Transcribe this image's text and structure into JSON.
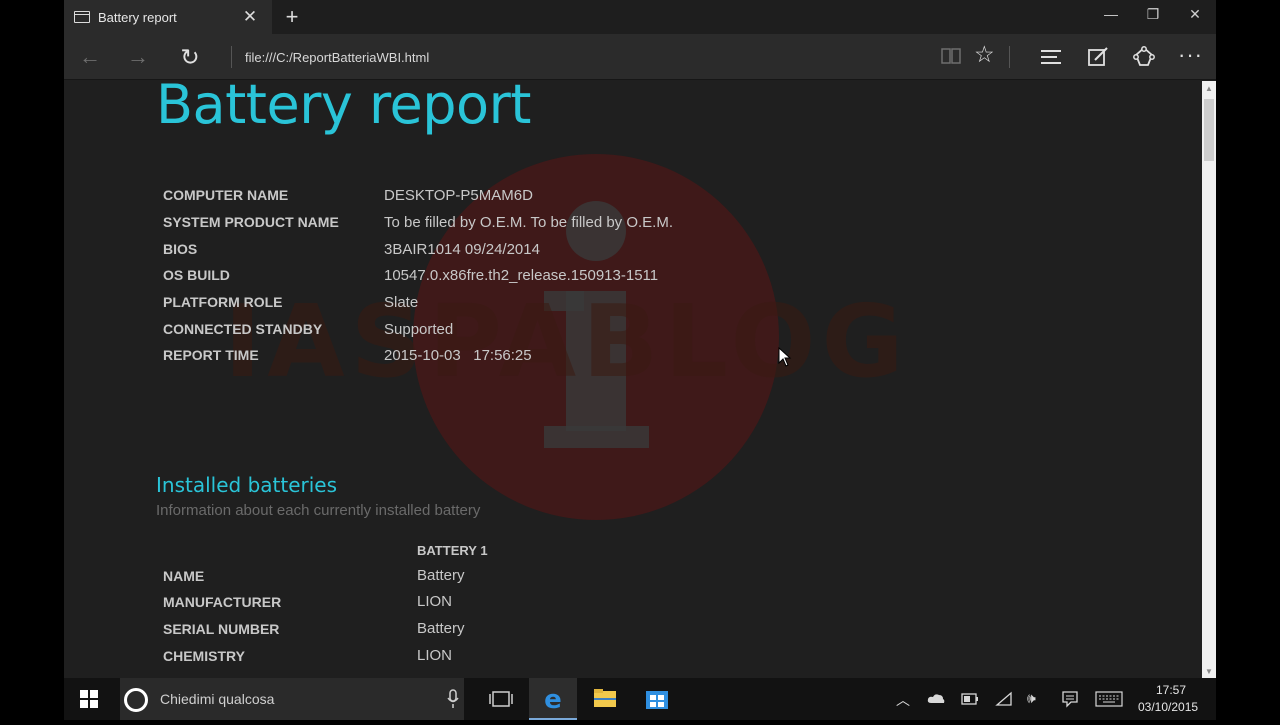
{
  "browser": {
    "tab_title": "Battery report",
    "url": "file:///C:/ReportBatteriaWBI.html",
    "icons": {
      "back": "arrow-left",
      "forward": "arrow-right",
      "refresh": "refresh",
      "reading_view": "book",
      "favorite": "star",
      "hub": "hamburger-lines",
      "web_note": "pen-square",
      "share": "share",
      "more": "ellipsis"
    }
  },
  "report": {
    "title": "Battery report",
    "info": [
      {
        "label": "COMPUTER NAME",
        "value": "DESKTOP-P5MAM6D"
      },
      {
        "label": "SYSTEM PRODUCT NAME",
        "value": "To be filled by O.E.M. To be filled by O.E.M."
      },
      {
        "label": "BIOS",
        "value": "3BAIR1014 09/24/2014"
      },
      {
        "label": "OS BUILD",
        "value": "10547.0.x86fre.th2_release.150913-1511"
      },
      {
        "label": "PLATFORM ROLE",
        "value": "Slate"
      },
      {
        "label": "CONNECTED STANDBY",
        "value": "Supported"
      },
      {
        "label": "REPORT TIME",
        "value": "2015-10-03   17:56:25"
      }
    ],
    "installed": {
      "title": "Installed batteries",
      "subtitle": "Information about each currently installed battery",
      "column_header": "BATTERY 1",
      "rows": [
        {
          "label": "NAME",
          "value": "Battery"
        },
        {
          "label": "MANUFACTURER",
          "value": "LION"
        },
        {
          "label": "SERIAL NUMBER",
          "value": "Battery"
        },
        {
          "label": "CHEMISTRY",
          "value": "LION"
        }
      ]
    },
    "watermark_text": "IASPABLOG"
  },
  "taskbar": {
    "search_placeholder": "Chiedimi qualcosa",
    "time": "17:57",
    "date": "03/10/2015"
  },
  "colors": {
    "accent": "#2ac4d8",
    "page_bg": "#1f1f1f",
    "taskbar_bg": "#121212"
  }
}
